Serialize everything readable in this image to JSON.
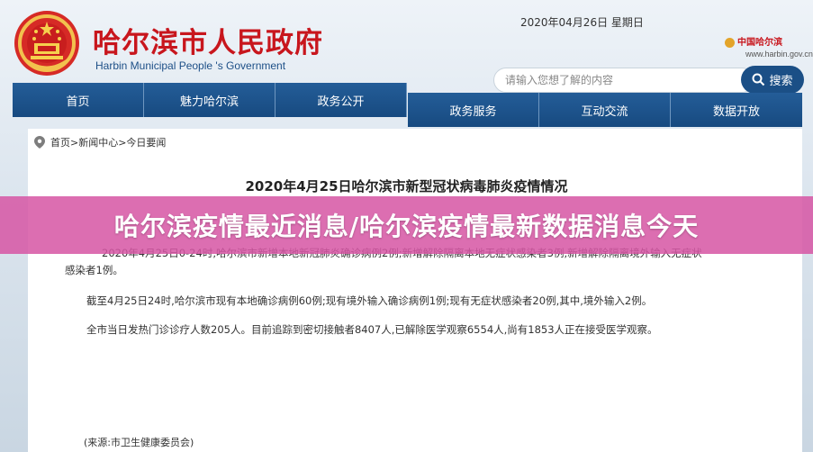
{
  "header": {
    "title": "哈尔滨市人民政府",
    "subtitle": "Harbin Municipal People 's Government",
    "date": "2020年04月26日 星期日",
    "logo_mini": "中国哈尔滨",
    "url": "www.harbin.gov.cn"
  },
  "search": {
    "placeholder": "请输入您想了解的内容",
    "button_label": "搜索"
  },
  "nav": {
    "row1": [
      "首页",
      "魅力哈尔滨",
      "政务公开"
    ],
    "row2": [
      "政务服务",
      "互动交流",
      "数据开放"
    ]
  },
  "breadcrumb": "首页>新闻中心>今日要闻",
  "article": {
    "title": "2020年4月25日哈尔滨市新型冠状病毒肺炎疫情情况",
    "para1_line1": "2020年4月25日0-24时,哈尔滨市新增本地新冠肺炎确诊病例2例;新增解除隔离本地无症状感染者3例,新增解除隔离境外输入无症状",
    "para1_line2": "感染者1例。",
    "para2": "截至4月25日24时,哈尔滨市现有本地确诊病例60例;现有境外输入确诊病例1例;现有无症状感染者20例,其中,境外输入2例。",
    "para3": "全市当日发热门诊诊疗人数205人。目前追踪到密切接触者8407人,已解除医学观察6554人,尚有1853人正在接受医学观察。",
    "source": "(来源:市卫生健康委员会)"
  },
  "banner": {
    "text": "哈尔滨疫情最近消息/哈尔滨疫情最新数据消息今天"
  },
  "colors": {
    "brand_red": "#c8161d",
    "nav_blue": "#1b4f86",
    "banner_pink": "#d656a4"
  }
}
